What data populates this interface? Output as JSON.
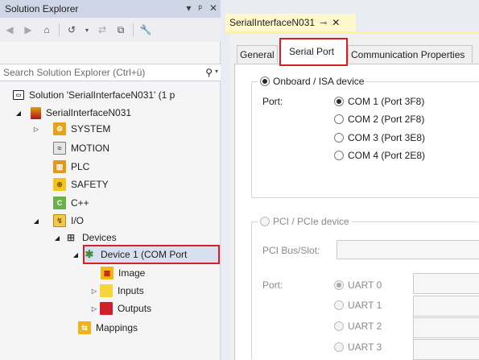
{
  "solution_explorer": {
    "title": "Solution Explorer",
    "title_controls": [
      "▾",
      "ᵖ",
      "✕"
    ],
    "search_placeholder": "Search Solution Explorer (Ctrl+ü)",
    "tree": [
      {
        "label": "Solution 'SerialInterfaceN031' (1 p",
        "icon": "solution-icon"
      },
      {
        "label": "SerialInterfaceN031",
        "icon": "twincat-project-icon"
      },
      {
        "label": "SYSTEM",
        "icon": "system-icon"
      },
      {
        "label": "MOTION",
        "icon": "motion-icon"
      },
      {
        "label": "PLC",
        "icon": "plc-icon"
      },
      {
        "label": "SAFETY",
        "icon": "safety-icon"
      },
      {
        "label": "C++",
        "icon": "cpp-icon"
      },
      {
        "label": "I/O",
        "icon": "io-icon"
      },
      {
        "label": "Devices",
        "icon": "devices-icon"
      },
      {
        "label": "Device 1 (COM Port",
        "icon": "device-icon"
      },
      {
        "label": "Image",
        "icon": "image-icon"
      },
      {
        "label": "Inputs",
        "icon": "inputs-icon"
      },
      {
        "label": "Outputs",
        "icon": "outputs-icon"
      },
      {
        "label": "Mappings",
        "icon": "mappings-icon"
      }
    ]
  },
  "editor": {
    "document_tab": "SerialInterfaceN031",
    "tabs": [
      {
        "label": "General"
      },
      {
        "label": "Serial Port"
      },
      {
        "label": "Communication Properties"
      }
    ],
    "onboard_group": {
      "label": "Onboard / ISA device",
      "port_label": "Port:",
      "options": [
        "COM 1 (Port 3F8)",
        "COM 2 (Port 2F8)",
        "COM 3 (Port 3E8)",
        "COM 4 (Port 2E8)"
      ]
    },
    "pci_group": {
      "label": "PCI / PCIe device",
      "bus_label": "PCI Bus/Slot:",
      "port_label": "Port:",
      "options": [
        "UART 0",
        "UART 1",
        "UART 2",
        "UART 3"
      ]
    }
  },
  "colors": {
    "highlight": "#d62027",
    "active_tab": "#fff29d"
  }
}
